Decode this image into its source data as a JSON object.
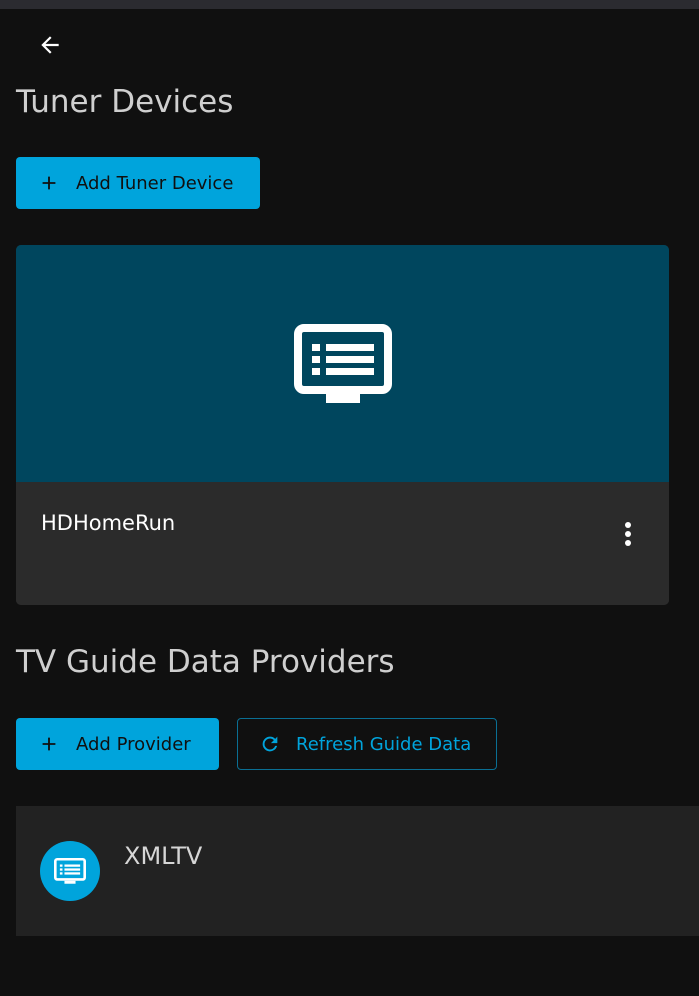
{
  "header": {
    "back_icon": "arrow-left-icon"
  },
  "tuners": {
    "title": "Tuner Devices",
    "add_button_label": "Add Tuner Device",
    "add_button_icon": "plus-icon",
    "devices": [
      {
        "name": "HDHomeRun",
        "image_icon": "tv-guide-icon",
        "menu_icon": "more-vertical-icon"
      }
    ]
  },
  "guide": {
    "title": "TV Guide Data Providers",
    "add_button_label": "Add Provider",
    "add_button_icon": "plus-icon",
    "refresh_button_label": "Refresh Guide Data",
    "refresh_button_icon": "refresh-icon",
    "providers": [
      {
        "name": "XMLTV",
        "icon": "tv-guide-icon"
      }
    ]
  },
  "colors": {
    "background": "#101010",
    "accent": "#00a4dc",
    "card_image_bg": "#00465e",
    "card_footer_bg": "#2b2b2b",
    "list_row_bg": "#222222",
    "title_text": "#cfcfcf"
  }
}
